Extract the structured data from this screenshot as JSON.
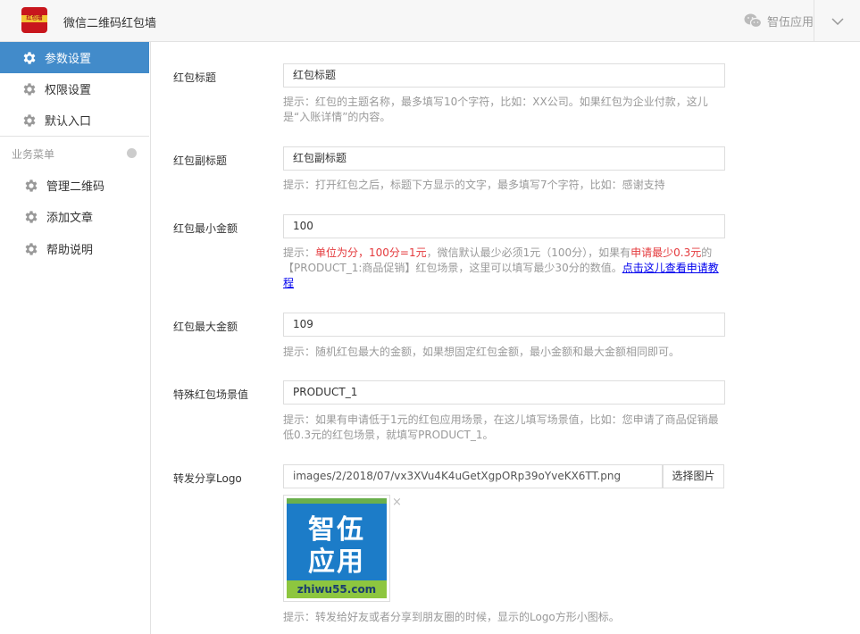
{
  "header": {
    "logo_text": "红包墙",
    "app_title": "微信二维码红包墙",
    "brand_name": "智伍应用"
  },
  "sidebar": {
    "items": [
      {
        "label": "参数设置",
        "active": true
      },
      {
        "label": "权限设置"
      },
      {
        "label": "默认入口"
      }
    ],
    "group_title": "业务菜单",
    "sub_items": [
      {
        "label": "管理二维码"
      },
      {
        "label": "添加文章"
      },
      {
        "label": "帮助说明"
      }
    ]
  },
  "form": {
    "title": {
      "label": "红包标题",
      "value": "红包标题",
      "hint": "提示：红包的主题名称，最多填写10个字符，比如：XX公司。如果红包为企业付款，这儿是“入账详情”的内容。"
    },
    "subtitle": {
      "label": "红包副标题",
      "value": "红包副标题",
      "hint": "提示：打开红包之后，标题下方显示的文字，最多填写7个字符，比如：感谢支持"
    },
    "min_amount": {
      "label": "红包最小金额",
      "value": "100",
      "hint_prefix": "提示：",
      "hint_red1": "单位为分，100分=1元",
      "hint_mid": "，微信默认最少必须1元（100分），如果有",
      "hint_red2": "申请最少0.3元",
      "hint_after": "的【PRODUCT_1:商品促销】红包场景，这里可以填写最少30分的数值。",
      "hint_link": "点击这儿查看申请教程"
    },
    "max_amount": {
      "label": "红包最大金额",
      "value": "109",
      "hint": "提示：随机红包最大的金额，如果想固定红包金额，最小金额和最大金额相同即可。"
    },
    "scene": {
      "label": "特殊红包场景值",
      "value": "PRODUCT_1",
      "hint": "提示：如果有申请低于1元的红包应用场景，在这儿填写场景值，比如：您申请了商品促销最低0.3元的红包场景，就填写PRODUCT_1。"
    },
    "logo": {
      "label": "转发分享Logo",
      "value": "images/2/2018/07/vx3XVu4K4uGetXgpORp39oYveKX6TT.png",
      "button": "选择图片",
      "thumb_row1": "智伍",
      "thumb_row2": "应用",
      "thumb_footer": "zhiwu55.com",
      "close_glyph": "×",
      "hint": "提示：转发给好友或者分享到朋友圈的时候，显示的Logo方形小图标。"
    }
  },
  "colors": {
    "active_menu": "#428bca",
    "hint_red": "#e4393c",
    "link": "#0000ee"
  }
}
